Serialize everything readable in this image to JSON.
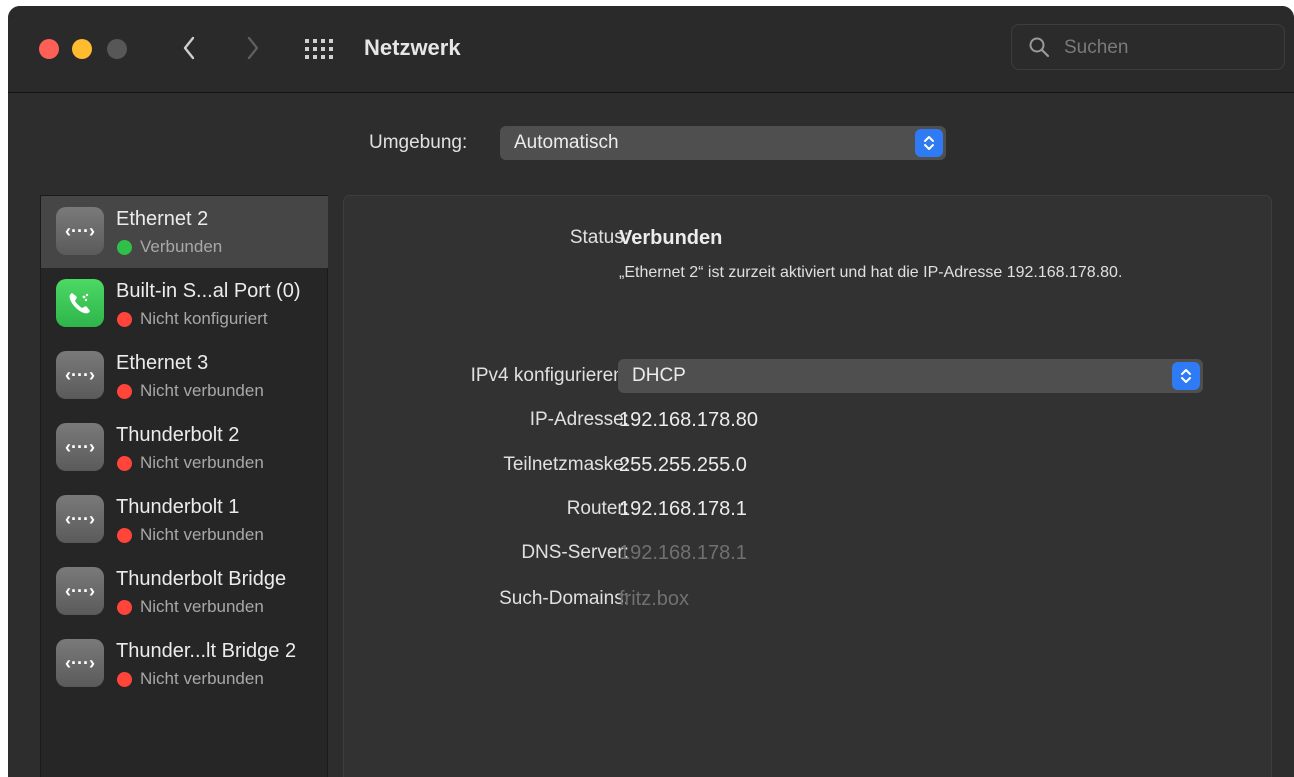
{
  "window": {
    "title": "Netzwerk",
    "search_placeholder": "Suchen"
  },
  "location": {
    "label": "Umgebung:",
    "value": "Automatisch"
  },
  "services": [
    {
      "name": "Ethernet 2",
      "status": "Verbunden",
      "status_color": "#30c04a",
      "icon": "ethernet-icon",
      "selected": true
    },
    {
      "name": "Built-in S...al Port (0)",
      "status": "Nicht konfiguriert",
      "status_color": "#ff453a",
      "icon": "phone-icon",
      "selected": false
    },
    {
      "name": "Ethernet 3",
      "status": "Nicht verbunden",
      "status_color": "#ff453a",
      "icon": "ethernet-icon",
      "selected": false
    },
    {
      "name": "Thunderbolt 2",
      "status": "Nicht verbunden",
      "status_color": "#ff453a",
      "icon": "ethernet-icon",
      "selected": false
    },
    {
      "name": "Thunderbolt 1",
      "status": "Nicht verbunden",
      "status_color": "#ff453a",
      "icon": "ethernet-icon",
      "selected": false
    },
    {
      "name": "Thunderbolt Bridge",
      "status": "Nicht verbunden",
      "status_color": "#ff453a",
      "icon": "ethernet-icon",
      "selected": false
    },
    {
      "name": "Thunder...lt Bridge 2",
      "status": "Nicht verbunden",
      "status_color": "#ff453a",
      "icon": "ethernet-icon",
      "selected": false
    }
  ],
  "detail": {
    "status_label": "Status:",
    "status_value": "Verbunden",
    "status_description": "„Ethernet 2“ ist zurzeit aktiviert und hat die IP-Adresse 192.168.178.80.",
    "ipv4_label": "IPv4 konfigurieren:",
    "ipv4_value": "DHCP",
    "ip_label": "IP-Adresse:",
    "ip_value": "192.168.178.80",
    "subnet_label": "Teilnetzmaske:",
    "subnet_value": "255.255.255.0",
    "router_label": "Router:",
    "router_value": "192.168.178.1",
    "dns_label": "DNS-Server:",
    "dns_value": "192.168.178.1",
    "domains_label": "Such-Domains:",
    "domains_value": "fritz.box"
  },
  "colors": {
    "accent": "#2f7bf5",
    "connected": "#30c04a",
    "disconnected": "#ff453a"
  }
}
